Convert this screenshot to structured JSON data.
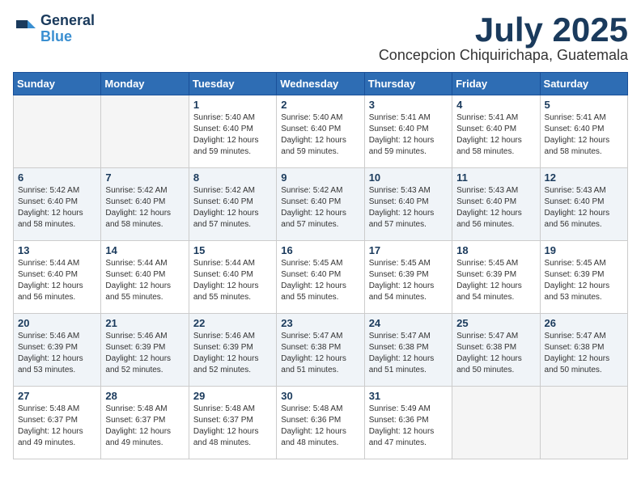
{
  "header": {
    "logo_line1": "General",
    "logo_line2": "Blue",
    "month": "July 2025",
    "location": "Concepcion Chiquirichapa, Guatemala"
  },
  "weekdays": [
    "Sunday",
    "Monday",
    "Tuesday",
    "Wednesday",
    "Thursday",
    "Friday",
    "Saturday"
  ],
  "weeks": [
    [
      {
        "day": "",
        "info": ""
      },
      {
        "day": "",
        "info": ""
      },
      {
        "day": "1",
        "info": "Sunrise: 5:40 AM\nSunset: 6:40 PM\nDaylight: 12 hours\nand 59 minutes."
      },
      {
        "day": "2",
        "info": "Sunrise: 5:40 AM\nSunset: 6:40 PM\nDaylight: 12 hours\nand 59 minutes."
      },
      {
        "day": "3",
        "info": "Sunrise: 5:41 AM\nSunset: 6:40 PM\nDaylight: 12 hours\nand 59 minutes."
      },
      {
        "day": "4",
        "info": "Sunrise: 5:41 AM\nSunset: 6:40 PM\nDaylight: 12 hours\nand 58 minutes."
      },
      {
        "day": "5",
        "info": "Sunrise: 5:41 AM\nSunset: 6:40 PM\nDaylight: 12 hours\nand 58 minutes."
      }
    ],
    [
      {
        "day": "6",
        "info": "Sunrise: 5:42 AM\nSunset: 6:40 PM\nDaylight: 12 hours\nand 58 minutes."
      },
      {
        "day": "7",
        "info": "Sunrise: 5:42 AM\nSunset: 6:40 PM\nDaylight: 12 hours\nand 58 minutes."
      },
      {
        "day": "8",
        "info": "Sunrise: 5:42 AM\nSunset: 6:40 PM\nDaylight: 12 hours\nand 57 minutes."
      },
      {
        "day": "9",
        "info": "Sunrise: 5:42 AM\nSunset: 6:40 PM\nDaylight: 12 hours\nand 57 minutes."
      },
      {
        "day": "10",
        "info": "Sunrise: 5:43 AM\nSunset: 6:40 PM\nDaylight: 12 hours\nand 57 minutes."
      },
      {
        "day": "11",
        "info": "Sunrise: 5:43 AM\nSunset: 6:40 PM\nDaylight: 12 hours\nand 56 minutes."
      },
      {
        "day": "12",
        "info": "Sunrise: 5:43 AM\nSunset: 6:40 PM\nDaylight: 12 hours\nand 56 minutes."
      }
    ],
    [
      {
        "day": "13",
        "info": "Sunrise: 5:44 AM\nSunset: 6:40 PM\nDaylight: 12 hours\nand 56 minutes."
      },
      {
        "day": "14",
        "info": "Sunrise: 5:44 AM\nSunset: 6:40 PM\nDaylight: 12 hours\nand 55 minutes."
      },
      {
        "day": "15",
        "info": "Sunrise: 5:44 AM\nSunset: 6:40 PM\nDaylight: 12 hours\nand 55 minutes."
      },
      {
        "day": "16",
        "info": "Sunrise: 5:45 AM\nSunset: 6:40 PM\nDaylight: 12 hours\nand 55 minutes."
      },
      {
        "day": "17",
        "info": "Sunrise: 5:45 AM\nSunset: 6:39 PM\nDaylight: 12 hours\nand 54 minutes."
      },
      {
        "day": "18",
        "info": "Sunrise: 5:45 AM\nSunset: 6:39 PM\nDaylight: 12 hours\nand 54 minutes."
      },
      {
        "day": "19",
        "info": "Sunrise: 5:45 AM\nSunset: 6:39 PM\nDaylight: 12 hours\nand 53 minutes."
      }
    ],
    [
      {
        "day": "20",
        "info": "Sunrise: 5:46 AM\nSunset: 6:39 PM\nDaylight: 12 hours\nand 53 minutes."
      },
      {
        "day": "21",
        "info": "Sunrise: 5:46 AM\nSunset: 6:39 PM\nDaylight: 12 hours\nand 52 minutes."
      },
      {
        "day": "22",
        "info": "Sunrise: 5:46 AM\nSunset: 6:39 PM\nDaylight: 12 hours\nand 52 minutes."
      },
      {
        "day": "23",
        "info": "Sunrise: 5:47 AM\nSunset: 6:38 PM\nDaylight: 12 hours\nand 51 minutes."
      },
      {
        "day": "24",
        "info": "Sunrise: 5:47 AM\nSunset: 6:38 PM\nDaylight: 12 hours\nand 51 minutes."
      },
      {
        "day": "25",
        "info": "Sunrise: 5:47 AM\nSunset: 6:38 PM\nDaylight: 12 hours\nand 50 minutes."
      },
      {
        "day": "26",
        "info": "Sunrise: 5:47 AM\nSunset: 6:38 PM\nDaylight: 12 hours\nand 50 minutes."
      }
    ],
    [
      {
        "day": "27",
        "info": "Sunrise: 5:48 AM\nSunset: 6:37 PM\nDaylight: 12 hours\nand 49 minutes."
      },
      {
        "day": "28",
        "info": "Sunrise: 5:48 AM\nSunset: 6:37 PM\nDaylight: 12 hours\nand 49 minutes."
      },
      {
        "day": "29",
        "info": "Sunrise: 5:48 AM\nSunset: 6:37 PM\nDaylight: 12 hours\nand 48 minutes."
      },
      {
        "day": "30",
        "info": "Sunrise: 5:48 AM\nSunset: 6:36 PM\nDaylight: 12 hours\nand 48 minutes."
      },
      {
        "day": "31",
        "info": "Sunrise: 5:49 AM\nSunset: 6:36 PM\nDaylight: 12 hours\nand 47 minutes."
      },
      {
        "day": "",
        "info": ""
      },
      {
        "day": "",
        "info": ""
      }
    ]
  ]
}
